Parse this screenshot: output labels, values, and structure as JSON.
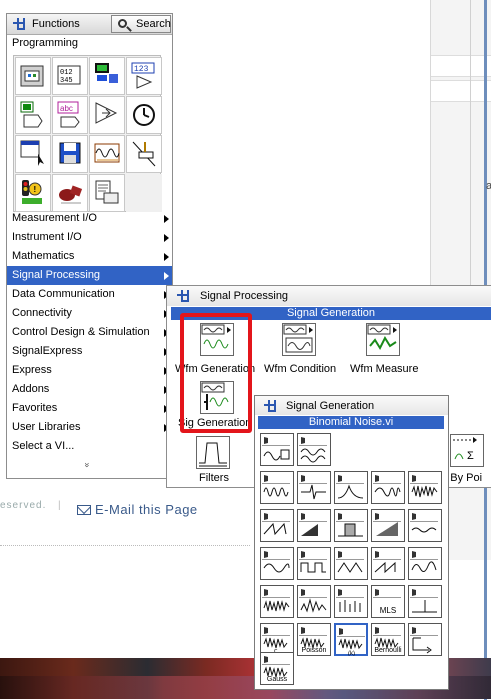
{
  "background": {
    "footer_fragment": "eserved.",
    "footer_separator": "|",
    "email_link": "E-Mail this Page",
    "right_fragment": "a"
  },
  "functions_palette": {
    "title": "Functions",
    "search_label": "Search",
    "category": "Programming",
    "grid_icons": [
      "cluster-icon",
      "array-icon",
      "structure-icon",
      "numeric-icon",
      "boolean-icon",
      "string-icon",
      "comparison-icon",
      "timing-icon",
      "dialog-icon",
      "file-io-icon",
      "waveform-icon",
      "app-control-icon",
      "sync-icon",
      "graphics-icon",
      "report-icon"
    ],
    "menu_items": [
      {
        "label": "Measurement I/O",
        "arrow": true
      },
      {
        "label": "Instrument I/O",
        "arrow": true
      },
      {
        "label": "Mathematics",
        "arrow": true
      },
      {
        "label": "Signal Processing",
        "arrow": true,
        "selected": true
      },
      {
        "label": "Data Communication",
        "arrow": true
      },
      {
        "label": "Connectivity",
        "arrow": true
      },
      {
        "label": "Control Design & Simulation",
        "arrow": true
      },
      {
        "label": "SignalExpress",
        "arrow": true
      },
      {
        "label": "Express",
        "arrow": true
      },
      {
        "label": "Addons",
        "arrow": true
      },
      {
        "label": "Favorites",
        "arrow": true
      },
      {
        "label": "User Libraries",
        "arrow": true
      },
      {
        "label": "Select a VI...",
        "arrow": false
      }
    ],
    "more_glyph": "»"
  },
  "signal_processing_palette": {
    "title": "Signal Processing",
    "subtitle": "Signal Generation",
    "items": [
      {
        "label": "Wfm Generation"
      },
      {
        "label": "Wfm Condition"
      },
      {
        "label": "Wfm Measure"
      },
      {
        "label": "Sig Generation"
      },
      {
        "label": "Filters"
      },
      {
        "label": "Pt By Point"
      }
    ],
    "partial_label": "nt By Poi"
  },
  "signal_generation_palette": {
    "title": "Signal Generation",
    "subtitle": "Binomial Noise.vi",
    "icon_labels": {
      "poisson": "Poisson",
      "bernoulli": "Bernoulli",
      "mls": "MLS",
      "gauss": "Gauss"
    }
  },
  "colors": {
    "selection": "#3163c5",
    "highlight_box": "#e3151b",
    "link": "#3a5a8a"
  }
}
